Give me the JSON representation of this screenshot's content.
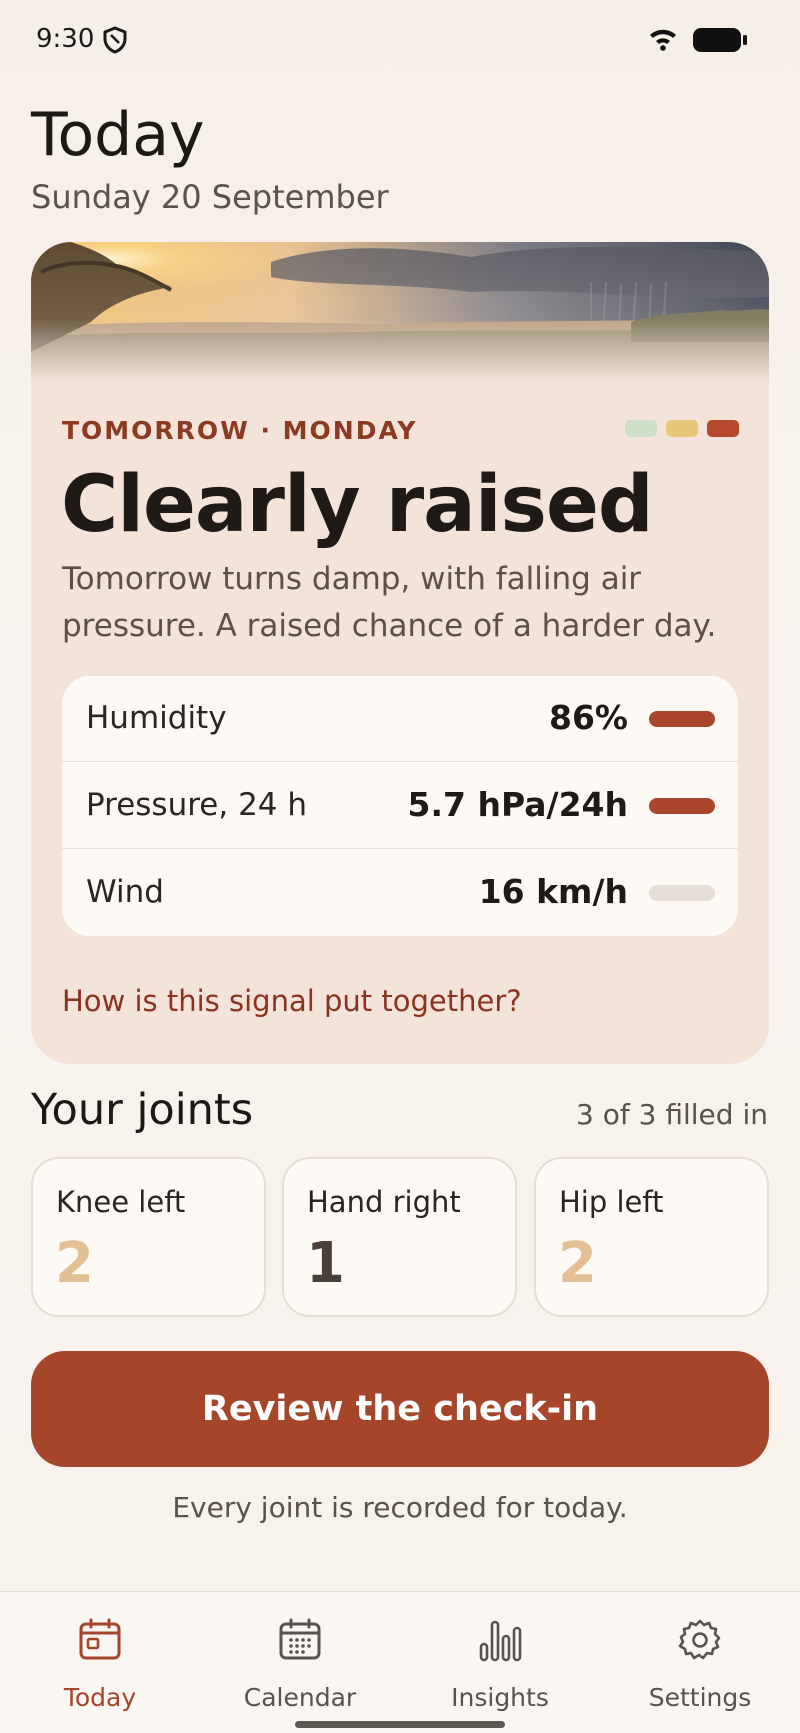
{
  "status_bar": {
    "time": "9:30"
  },
  "header": {
    "title": "Today",
    "date": "Sunday 20 September"
  },
  "forecast_card": {
    "eyebrow": "TOMORROW · MONDAY",
    "level_colors": [
      "#cfe0c8",
      "#e8c77a",
      "#b7482d"
    ],
    "headline": "Clearly raised",
    "description": "Tomorrow turns damp, with falling air pressure. A raised chance of a harder day.",
    "metrics": [
      {
        "label": "Humidity",
        "value": "86%",
        "bar_color": "#a9462b"
      },
      {
        "label": "Pressure, 24 h",
        "value": "5.7 hPa/24h",
        "bar_color": "#a9462b"
      },
      {
        "label": "Wind",
        "value": "16 km/h",
        "bar_color": "#e6ddd4"
      }
    ],
    "link": "How is this signal put together?"
  },
  "joints": {
    "title": "Your joints",
    "count": "3 of 3 filled in",
    "items": [
      {
        "name": "Knee left",
        "score": "2",
        "color": "#e2bf94"
      },
      {
        "name": "Hand right",
        "score": "1",
        "color": "#4a3f37"
      },
      {
        "name": "Hip left",
        "score": "2",
        "color": "#e2bf94"
      }
    ]
  },
  "primary_action": {
    "label": "Review the check-in"
  },
  "helper_text": "Every joint is recorded for today.",
  "bottom_nav": {
    "items": [
      {
        "label": "Today",
        "icon": "calendar-day-icon",
        "active": true
      },
      {
        "label": "Calendar",
        "icon": "calendar-grid-icon",
        "active": false
      },
      {
        "label": "Insights",
        "icon": "bar-chart-icon",
        "active": false
      },
      {
        "label": "Settings",
        "icon": "gear-icon",
        "active": false
      }
    ]
  },
  "colors": {
    "accent": "#a5452a",
    "card_bg": "#f4e3d9",
    "page_bg": "#f7f2ec"
  }
}
